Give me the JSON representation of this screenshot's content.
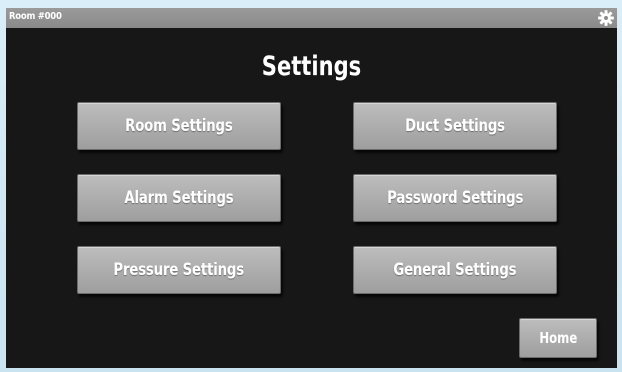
{
  "titlebar": {
    "room_label": "Room #000",
    "settings_icon": "gear-icon"
  },
  "page": {
    "title": "Settings"
  },
  "buttons": {
    "room_settings": "Room Settings",
    "duct_settings": "Duct Settings",
    "alarm_settings": "Alarm Settings",
    "password_settings": "Password Settings",
    "pressure_settings": "Pressure Settings",
    "general_settings": "General Settings",
    "home": "Home"
  },
  "colors": {
    "screen_background": "#171717",
    "titlebar_background": "#8a8a8a",
    "button_face": "#a8a8a8",
    "text": "#ffffff"
  }
}
